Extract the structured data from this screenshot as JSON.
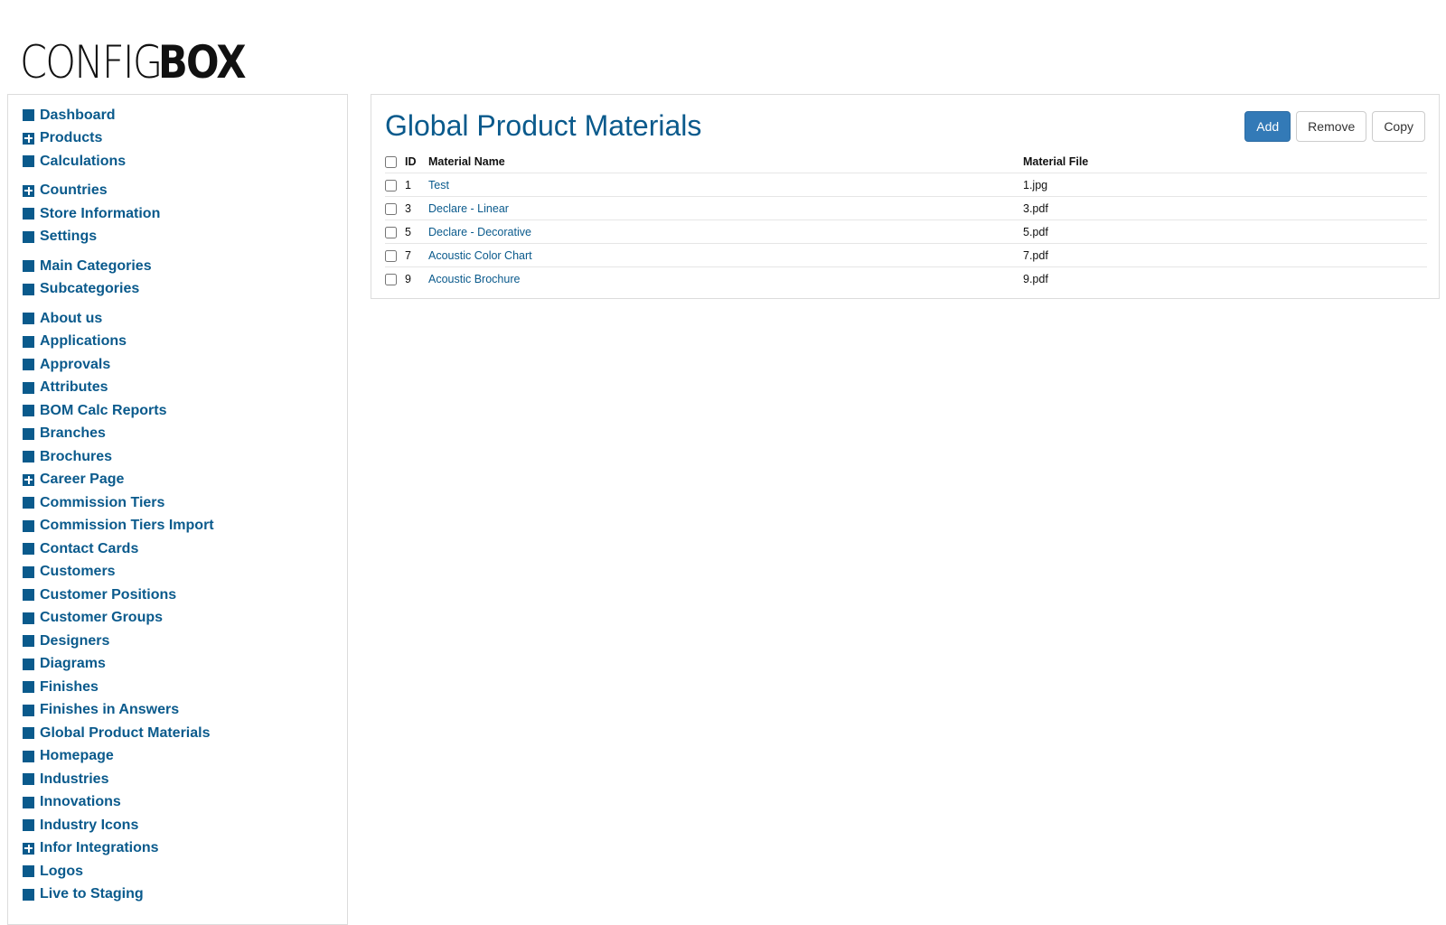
{
  "logo": {
    "light": "CONFIG",
    "bold": "BOX"
  },
  "sidebar": {
    "groups": [
      [
        {
          "label": "Dashboard",
          "icon": "square"
        },
        {
          "label": "Products",
          "icon": "plus"
        },
        {
          "label": "Calculations",
          "icon": "square"
        }
      ],
      [
        {
          "label": "Countries",
          "icon": "plus"
        },
        {
          "label": "Store Information",
          "icon": "square"
        },
        {
          "label": "Settings",
          "icon": "square"
        }
      ],
      [
        {
          "label": "Main Categories",
          "icon": "square"
        },
        {
          "label": "Subcategories",
          "icon": "square"
        }
      ],
      [
        {
          "label": "About us",
          "icon": "square"
        },
        {
          "label": "Applications",
          "icon": "square"
        },
        {
          "label": "Approvals",
          "icon": "square"
        },
        {
          "label": "Attributes",
          "icon": "square"
        },
        {
          "label": "BOM Calc Reports",
          "icon": "square"
        },
        {
          "label": "Branches",
          "icon": "square"
        },
        {
          "label": "Brochures",
          "icon": "square"
        },
        {
          "label": "Career Page",
          "icon": "plus"
        },
        {
          "label": "Commission Tiers",
          "icon": "square"
        },
        {
          "label": "Commission Tiers Import",
          "icon": "square"
        },
        {
          "label": "Contact Cards",
          "icon": "square"
        },
        {
          "label": "Customers",
          "icon": "square"
        },
        {
          "label": "Customer Positions",
          "icon": "square"
        },
        {
          "label": "Customer Groups",
          "icon": "square"
        },
        {
          "label": "Designers",
          "icon": "square"
        },
        {
          "label": "Diagrams",
          "icon": "square"
        },
        {
          "label": "Finishes",
          "icon": "square"
        },
        {
          "label": "Finishes in Answers",
          "icon": "square"
        },
        {
          "label": "Global Product Materials",
          "icon": "square"
        },
        {
          "label": "Homepage",
          "icon": "square"
        },
        {
          "label": "Industries",
          "icon": "square"
        },
        {
          "label": "Innovations",
          "icon": "square"
        },
        {
          "label": "Industry Icons",
          "icon": "square"
        },
        {
          "label": "Infor Integrations",
          "icon": "plus"
        },
        {
          "label": "Logos",
          "icon": "square"
        },
        {
          "label": "Live to Staging",
          "icon": "square"
        }
      ]
    ]
  },
  "main": {
    "title": "Global Product Materials",
    "buttons": {
      "add": "Add",
      "remove": "Remove",
      "copy": "Copy"
    },
    "table": {
      "headers": {
        "id": "ID",
        "name": "Material Name",
        "file": "Material File"
      },
      "rows": [
        {
          "id": "1",
          "name": "Test",
          "file": "1.jpg"
        },
        {
          "id": "3",
          "name": "Declare - Linear",
          "file": "3.pdf"
        },
        {
          "id": "5",
          "name": "Declare - Decorative",
          "file": "5.pdf"
        },
        {
          "id": "7",
          "name": "Acoustic Color Chart",
          "file": "7.pdf"
        },
        {
          "id": "9",
          "name": "Acoustic Brochure",
          "file": "9.pdf"
        }
      ]
    }
  },
  "colors": {
    "brand_blue": "#0a5a8c",
    "primary_button": "#337ab7",
    "border": "#dcdcdc"
  }
}
